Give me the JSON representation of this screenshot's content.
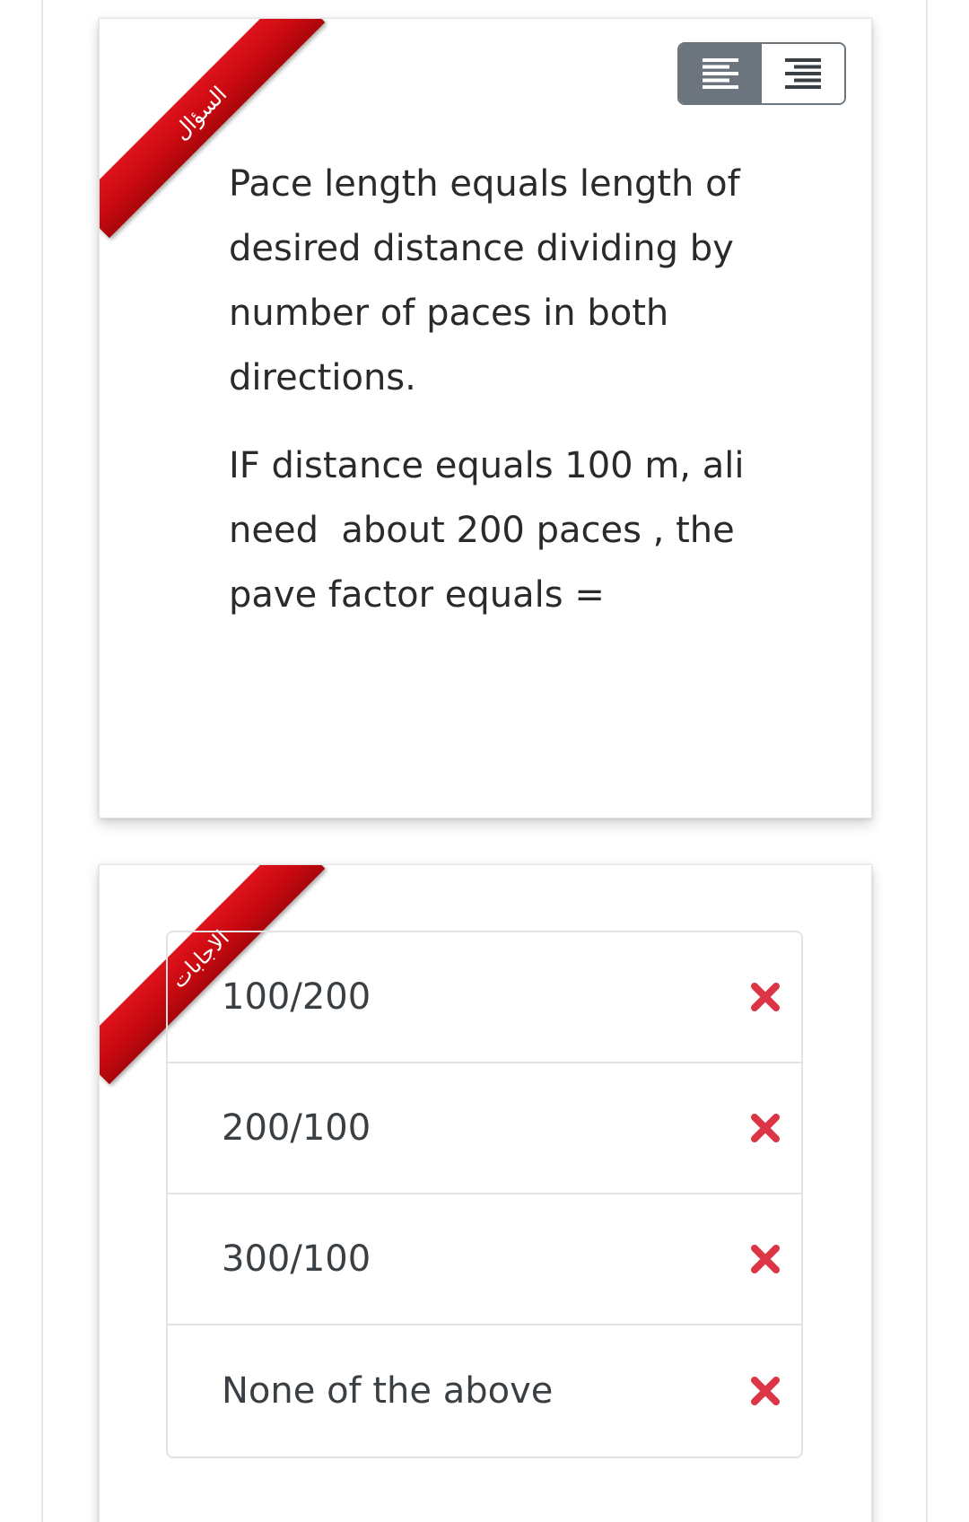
{
  "question_card": {
    "ribbon_label": "السؤال",
    "paragraphs": [
      "Pace length equals length of desired distance dividing by number of paces in both directions.",
      "IF distance equals 100 m, ali need  about 200 paces , the pave factor equals ="
    ]
  },
  "answers_card": {
    "ribbon_label": "الاجابات",
    "options": [
      {
        "label": "100/200",
        "status_icon": "x-mark-icon"
      },
      {
        "label": "200/100",
        "status_icon": "x-mark-icon"
      },
      {
        "label": "300/100",
        "status_icon": "x-mark-icon"
      },
      {
        "label": "None of the above",
        "status_icon": "x-mark-icon"
      }
    ]
  },
  "colors": {
    "ribbon_red": "#c80910",
    "toggle_gray": "#6c757d",
    "x_mark_red": "#dc3545"
  }
}
